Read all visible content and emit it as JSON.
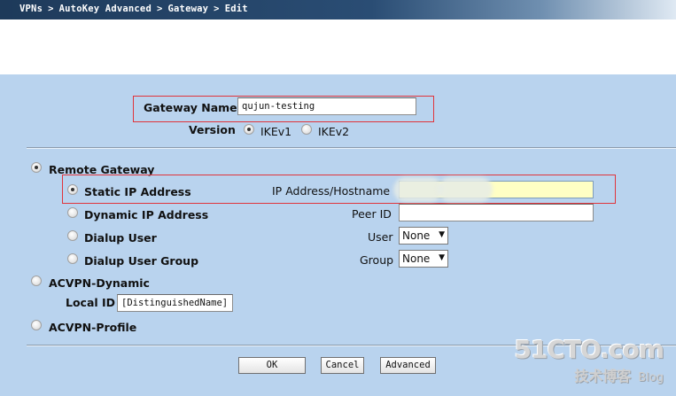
{
  "breadcrumb": {
    "items": [
      "VPNs",
      "AutoKey Advanced",
      "Gateway",
      "Edit"
    ],
    "separator": ">"
  },
  "gateway": {
    "name_label": "Gateway Name",
    "name_value": "qujun-testing"
  },
  "version": {
    "label": "Version",
    "options": [
      "IKEv1",
      "IKEv2"
    ],
    "selected": "IKEv1"
  },
  "remote_gateway": {
    "label": "Remote Gateway",
    "static_ip": {
      "label": "Static IP Address",
      "field_label": "IP Address/Hostname",
      "value": ""
    },
    "dynamic_ip": {
      "label": "Dynamic IP Address",
      "field_label": "Peer ID",
      "value": ""
    },
    "dialup_user": {
      "label": "Dialup User",
      "field_label": "User",
      "selected": "None"
    },
    "dialup_group": {
      "label": "Dialup User Group",
      "field_label": "Group",
      "selected": "None"
    }
  },
  "acvpn_dynamic": {
    "label": "ACVPN-Dynamic",
    "local_id_label": "Local ID",
    "local_id_value": "[DistinguishedName]"
  },
  "acvpn_profile": {
    "label": "ACVPN-Profile"
  },
  "buttons": {
    "ok": "OK",
    "cancel": "Cancel",
    "advanced": "Advanced"
  },
  "watermark": {
    "brand": "51CTO.com",
    "tagline": "技术博客",
    "blog": "Blog"
  },
  "colors": {
    "background": "#b9d3ee",
    "highlight_box": "#e0343b",
    "active_input": "#ffffc4"
  }
}
